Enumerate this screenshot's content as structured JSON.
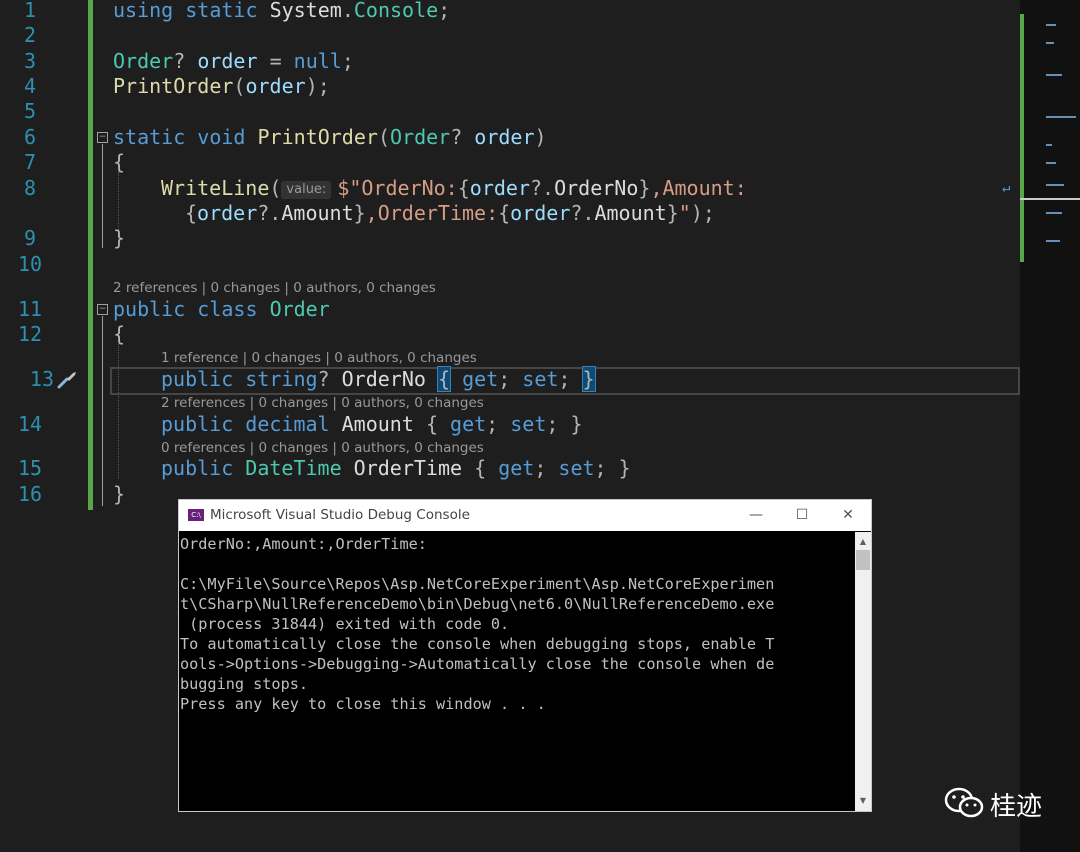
{
  "editor": {
    "line_numbers": [
      "1",
      "2",
      "3",
      "4",
      "5",
      "6",
      "7",
      "8",
      "9",
      "10",
      "11",
      "12",
      "13",
      "14",
      "15",
      "16"
    ],
    "code": {
      "l1": {
        "t1": "using",
        "t2": "static",
        "t3": "System",
        "t4": ".",
        "t5": "Console",
        "t6": ";"
      },
      "l3": {
        "t1": "Order",
        "t2": "?",
        "t3": "order",
        "t4": "=",
        "t5": "null",
        "t6": ";"
      },
      "l4": {
        "t1": "PrintOrder",
        "t2": "(",
        "t3": "order",
        "t4": ");"
      },
      "l6": {
        "t1": "static",
        "t2": "void",
        "t3": "PrintOrder",
        "t4": "(",
        "t5": "Order",
        "t6": "?",
        "t7": "order",
        "t8": ")"
      },
      "l7": {
        "t1": "{"
      },
      "l8": {
        "t1": "WriteLine",
        "t2": "(",
        "hint": "value:",
        "t3": "$\"OrderNo:",
        "t4": "{",
        "t5": "order",
        "t6": "?.",
        "t7": "OrderNo",
        "t8": "}",
        ",t9": "",
        "t10": ",Amount:"
      },
      "l8b": {
        "t1": "{",
        "t2": "order",
        "t3": "?.",
        "t4": "Amount",
        "t5": "}",
        "t6": ",OrderTime:",
        "t7": "{",
        "t8": "order",
        "t9": "?.",
        "t10": "Amount",
        "t11": "}",
        "t12": "\"",
        "t13": ");"
      },
      "l9": {
        "t1": "}"
      },
      "l11": {
        "t1": "public",
        "t2": "class",
        "t3": "Order"
      },
      "l12": {
        "t1": "{"
      },
      "l13": {
        "t1": "public",
        "t2": "string",
        "t3": "?",
        "t4": "OrderNo",
        "t5": "{",
        "t6": "get",
        "t7": ";",
        "t8": "set",
        "t9": ";",
        "t10": "}"
      },
      "l14": {
        "t1": "public",
        "t2": "decimal",
        "t3": "Amount",
        "t4": "{",
        "t5": "get",
        "t6": ";",
        "t7": "set",
        "t8": ";",
        "t9": "}"
      },
      "l15": {
        "t1": "public",
        "t2": "DateTime",
        "t3": "OrderTime",
        "t4": "{",
        "t5": "get",
        "t6": ";",
        "t7": "set",
        "t8": ";",
        "t9": "}"
      },
      "l16": {
        "t1": "}"
      }
    },
    "codelens": {
      "class_order": "2 references | 0 changes | 0 authors, 0 changes",
      "prop_orderno": "1 reference | 0 changes | 0 authors, 0 changes",
      "prop_amount": "2 references | 0 changes | 0 authors, 0 changes",
      "prop_ordertime": "0 references | 0 changes | 0 authors, 0 changes"
    },
    "fold_glyph": "−"
  },
  "console": {
    "title": "Microsoft Visual Studio Debug Console",
    "icon_text": "C:\\",
    "minimize": "—",
    "maximize": "☐",
    "close": "✕",
    "output": "OrderNo:,Amount:,OrderTime:\n\nC:\\MyFile\\Source\\Repos\\Asp.NetCoreExperiment\\Asp.NetCoreExperimen\nt\\CSharp\\NullReferenceDemo\\bin\\Debug\\net6.0\\NullReferenceDemo.exe\n (process 31844) exited with code 0.\nTo automatically close the console when debugging stops, enable T\nools->Options->Debugging->Automatically close the console when de\nbugging stops.\nPress any key to close this window . . .",
    "scroll_up": "▲",
    "scroll_down": "▼"
  },
  "watermark": {
    "text": "桂迹",
    "icon": "wechat-icon"
  },
  "colors": {
    "keyword": "#569cd6",
    "type": "#4ec9b0",
    "method": "#dcdcaa",
    "string": "#d69d85",
    "change_bar": "#57a64a",
    "line_number": "#2b91af"
  }
}
